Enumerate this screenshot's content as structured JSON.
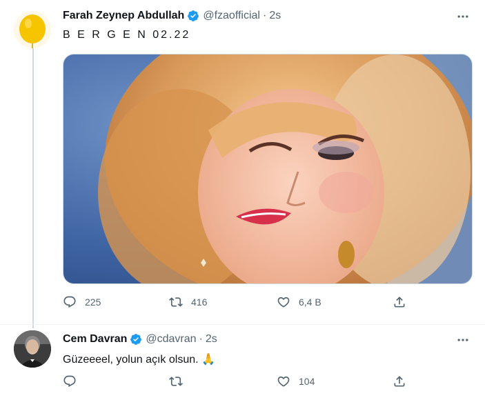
{
  "tweets": [
    {
      "name": "Farah Zeynep Abdullah",
      "handle": "@fzaofficial",
      "time": "2s",
      "text": "B E R G E N 02.22",
      "avatar_icon": "yellow-balloon-avatar",
      "actions": {
        "reply": "225",
        "retweet": "416",
        "like": "6,4 B",
        "share": ""
      }
    },
    {
      "name": "Cem Davran",
      "handle": "@cdavran",
      "time": "2s",
      "text": "Güzeeeel, yolun açık olsun.",
      "emoji": "🙏",
      "avatar_icon": "profile-photo-avatar",
      "actions": {
        "reply": "",
        "retweet": "",
        "like": "104",
        "share": ""
      }
    }
  ],
  "colors": {
    "verified": "#1d9bf0",
    "secondary_text": "#536471",
    "thread_line": "#cfd9de"
  }
}
